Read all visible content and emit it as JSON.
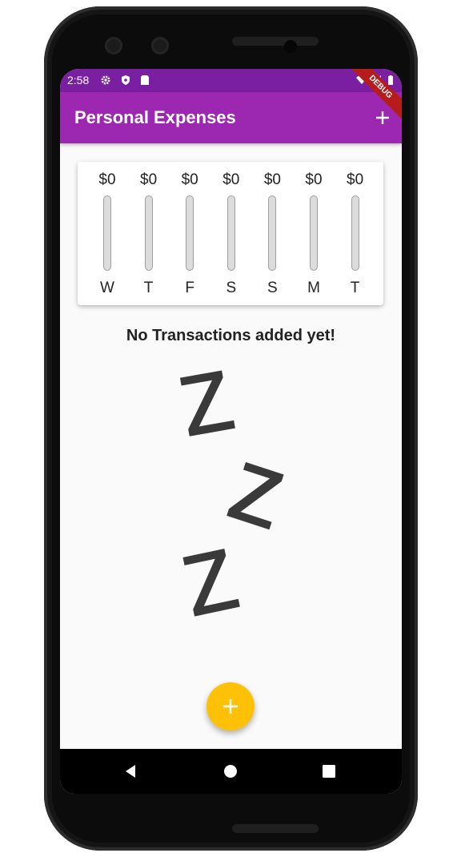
{
  "status_bar": {
    "time": "2:58"
  },
  "app_bar": {
    "title": "Personal Expenses",
    "add_icon": "plus-icon",
    "debug_banner": "DEBUG"
  },
  "chart_data": {
    "type": "bar",
    "categories": [
      "W",
      "T",
      "F",
      "S",
      "S",
      "M",
      "T"
    ],
    "labels": [
      "$0",
      "$0",
      "$0",
      "$0",
      "$0",
      "$0",
      "$0"
    ],
    "values": [
      0,
      0,
      0,
      0,
      0,
      0,
      0
    ],
    "title": ""
  },
  "empty_state": {
    "message": "No Transactions added yet!",
    "image": "sleeping-zzz-image"
  },
  "fab": {
    "icon": "plus-icon"
  },
  "colors": {
    "primary": "#9c27b0",
    "primary_dark": "#7b1fa2",
    "accent": "#ffc107"
  }
}
